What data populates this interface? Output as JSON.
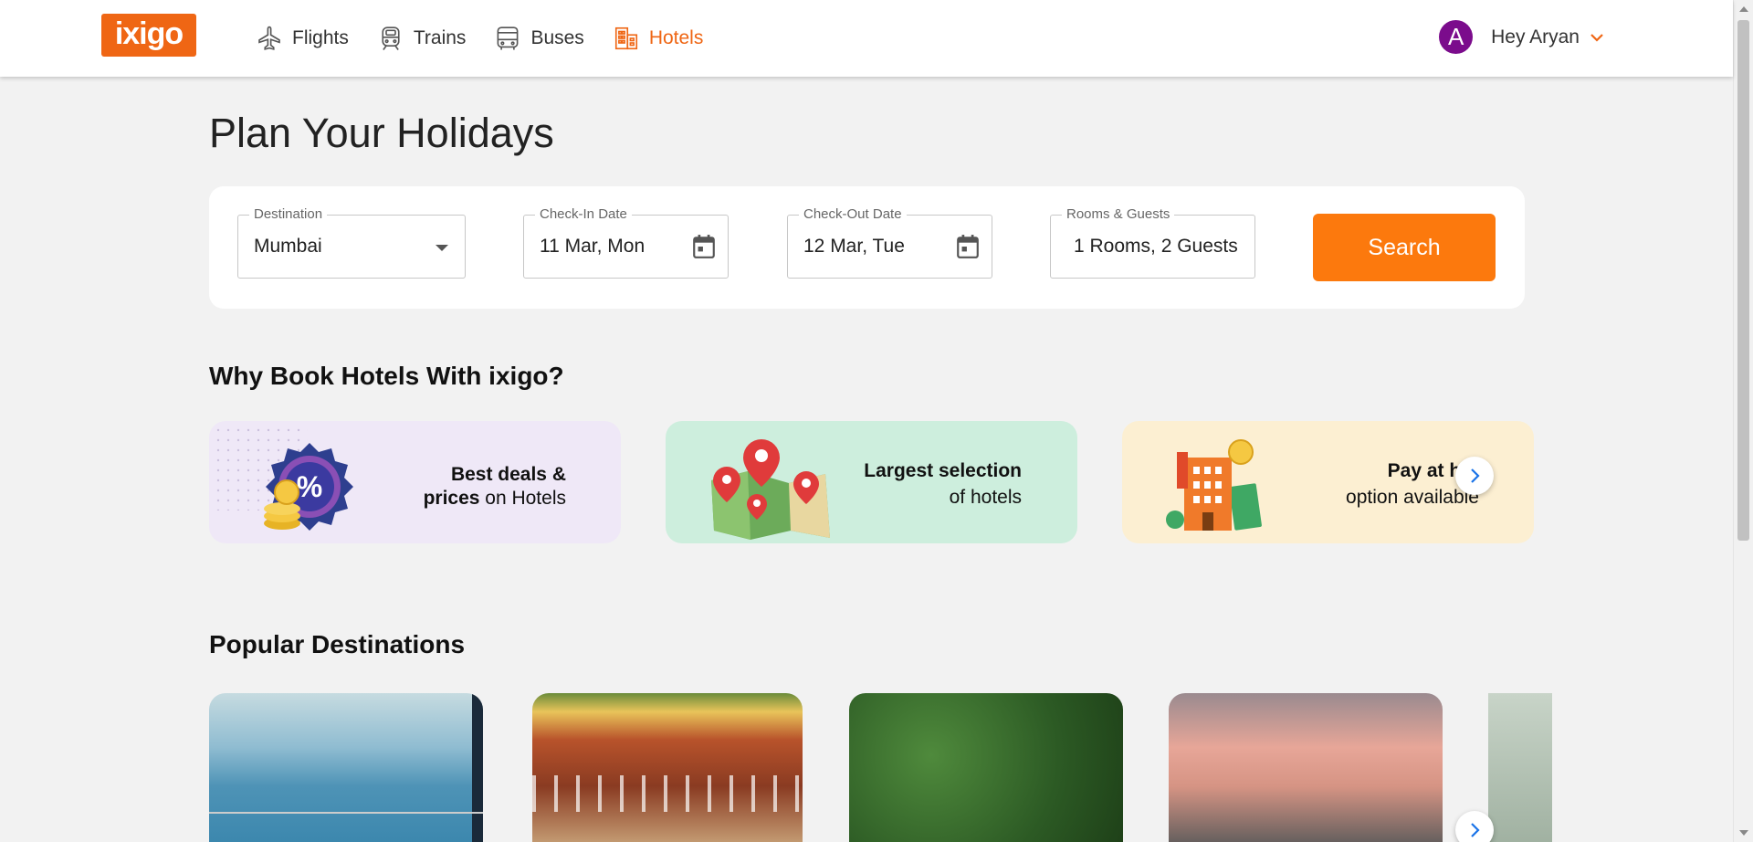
{
  "header": {
    "logo": "ixigo",
    "nav": [
      {
        "label": "Flights",
        "icon": "plane-icon"
      },
      {
        "label": "Trains",
        "icon": "train-icon"
      },
      {
        "label": "Buses",
        "icon": "bus-icon"
      },
      {
        "label": "Hotels",
        "icon": "hotel-icon",
        "active": true
      }
    ],
    "user": {
      "initial": "A",
      "greeting": "Hey Aryan"
    }
  },
  "page": {
    "title": "Plan Your Holidays"
  },
  "search": {
    "destination": {
      "label": "Destination",
      "value": "Mumbai"
    },
    "checkin": {
      "label": "Check-In Date",
      "value": "11 Mar, Mon"
    },
    "checkout": {
      "label": "Check-Out Date",
      "value": "12 Mar, Tue"
    },
    "guests": {
      "label": "Rooms & Guests",
      "value": "1 Rooms, 2 Guests"
    },
    "button": "Search"
  },
  "why": {
    "title": "Why Book Hotels With ixigo?",
    "cards": [
      {
        "line1_bold": "Best deals &",
        "line2_bold": "prices",
        "line2_rest": " on Hotels",
        "bg": "#efe8f7"
      },
      {
        "line1_bold": "Largest selection",
        "line2_rest": "of hotels",
        "bg": "#cdeedd"
      },
      {
        "line1_bold": "Pay at hot",
        "line2_rest": "option available",
        "bg": "#fcefd2"
      }
    ]
  },
  "popular": {
    "title": "Popular Destinations"
  },
  "colors": {
    "brand": "#ef6614",
    "search_button": "#fc790d",
    "avatar": "#7b0c8c",
    "link": "#1a73e8"
  }
}
